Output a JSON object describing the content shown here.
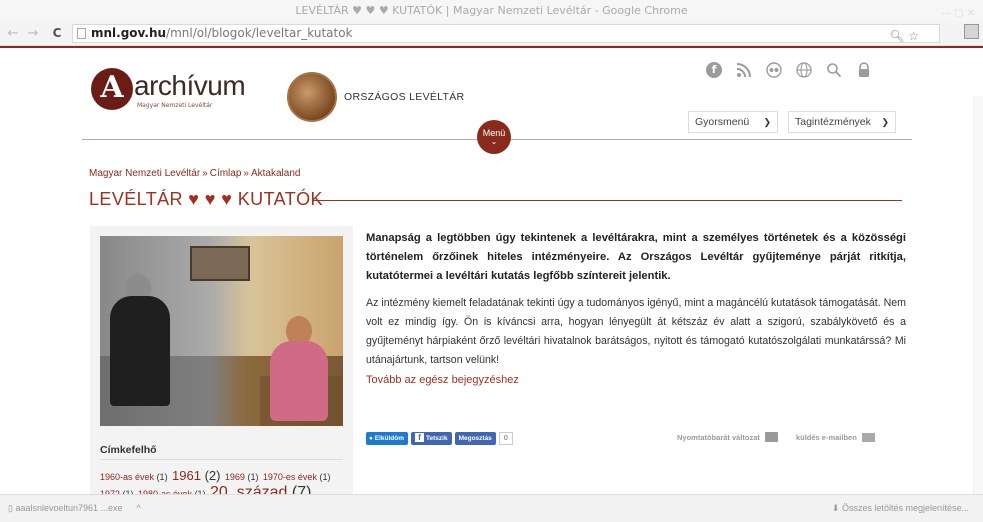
{
  "browser": {
    "window_title": "LEVÉLTÁR ♥ ♥ ♥ KUTATÓK | Magyar Nemzeti Levéltár - Google Chrome",
    "url_host": "mnl.gov.hu",
    "url_path": "/mnl/ol/blogok/leveltar_kutatok",
    "back": "←",
    "forward": "→",
    "reload": "C"
  },
  "header": {
    "logo_letter": "A",
    "logo_text": "archívum",
    "logo_sub": "Magyar Nemzeti Levéltár",
    "seal_label": "ORSZÁGOS LEVÉLTÁR",
    "icons": [
      "facebook-icon",
      "rss-icon",
      "flickr-icon",
      "globe-icon",
      "search-icon",
      "lock-icon"
    ],
    "quick_menu": "Gyorsmenü",
    "member_institutions": "Tagintézmények",
    "menu_label": "Menü"
  },
  "breadcrumb": [
    "Magyar Nemzeti Levéltár",
    "Címlap",
    "Aktakaland"
  ],
  "breadcrumb_sep": "»",
  "article": {
    "title": "LEVÉLTÁR ♥ ♥ ♥ KUTATÓK",
    "lead": "Manapság a legtöbben úgy tekintenek a levéltárakra, mint a személyes történetek és a közösségi történelem őrzőinek hiteles intézményeire. Az Országos Levéltár gyűjteménye párját ritkítja, kutatótermei a levéltári kutatás legfőbb színtereit jelentik.",
    "body": "Az intézmény kiemelt feladatának tekinti úgy a tudományos igényű, mint a magáncélú kutatások támogatását. Nem volt ez mindig így. Ön is kíváncsi arra, hogyan lényegült át kétszáz év alatt a szigorú, szabálykövető és a gyűjteményt hárpiaként őrző levéltári hivatalnok barátságos, nyitott és támogató kutatószolgálati munkatárssá? Mi utánajártunk, tartson velünk!",
    "more_link": "Tovább az egész bejegyzéshez"
  },
  "share": {
    "send": "Elküldöm",
    "like": "Tetszik",
    "share": "Megosztás",
    "count": "0",
    "print_label": "Nyomtatóbarát változat",
    "email_label": "küldés e-mailben"
  },
  "sidebar": {
    "tagcloud_title": "Címkefelhő",
    "tags": [
      {
        "label": "1960-as évek",
        "count": "(1)",
        "size": "small"
      },
      {
        "label": "1961",
        "count": "(2)",
        "size": "large"
      },
      {
        "label": "1969",
        "count": "(1)",
        "size": "small"
      },
      {
        "label": "1970-es évek",
        "count": "(1)",
        "size": "small"
      },
      {
        "label": "1972",
        "count": "(1)",
        "size": "small"
      },
      {
        "label": "1980-as évek",
        "count": "(1)",
        "size": "small"
      },
      {
        "label": "20. század",
        "count": "(7)",
        "size": "xlarge"
      }
    ]
  },
  "downloads": {
    "item": "aaalsnlevoeltun7961 ...exe",
    "item_chevron": "^",
    "show_all": "Összes letöltés megjelenítése..."
  }
}
